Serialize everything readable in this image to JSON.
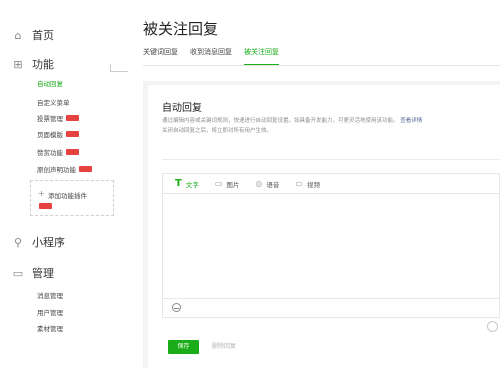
{
  "sidebar": {
    "home": {
      "label": "首页",
      "icon": "home-icon"
    },
    "features": {
      "label": "功能",
      "icon": "grid-icon",
      "items": [
        {
          "label": "自动回复",
          "active": true,
          "badge": false
        },
        {
          "label": "自定义菜单",
          "badge": false
        },
        {
          "label": "投票管理",
          "badge": true
        },
        {
          "label": "页面模版",
          "badge": true
        },
        {
          "label": "赞赏功能",
          "badge": true
        },
        {
          "label": "原创声明功能",
          "badge": true
        }
      ],
      "add_plugin": {
        "plus": "+",
        "label": "添加功能插件",
        "badge": true
      }
    },
    "miniprogram": {
      "label": "小程序",
      "icon": "link-icon"
    },
    "management": {
      "label": "管理",
      "icon": "chat-icon",
      "items": [
        {
          "label": "消息管理"
        },
        {
          "label": "用户管理"
        },
        {
          "label": "素材管理"
        }
      ]
    }
  },
  "header": {
    "title": "被关注回复",
    "tabs": [
      {
        "label": "关键词回复",
        "active": false
      },
      {
        "label": "收到消息回复",
        "active": false
      },
      {
        "label": "被关注回复",
        "active": true
      }
    ]
  },
  "auto_reply": {
    "title": "自动回复",
    "description": "通过编辑内容或关键词规则，快速进行自动回复设置。如具备开发能力，可更灵活地使用该功能。",
    "link": "查看详情",
    "description2": "关闭自动回复之后，将立即对所有用户生效。"
  },
  "editor": {
    "tools": [
      {
        "icon": "T",
        "label": "文字",
        "active": true
      },
      {
        "icon": "▭",
        "label": "图片",
        "active": false
      },
      {
        "icon": "◎",
        "label": "语音",
        "active": false
      },
      {
        "icon": "▭",
        "label": "视频",
        "active": false
      }
    ]
  },
  "actions": {
    "save": "保存",
    "delete": "删除回复"
  },
  "colors": {
    "accent": "#1aad19",
    "badge": "#e64340",
    "link": "#576b95"
  }
}
